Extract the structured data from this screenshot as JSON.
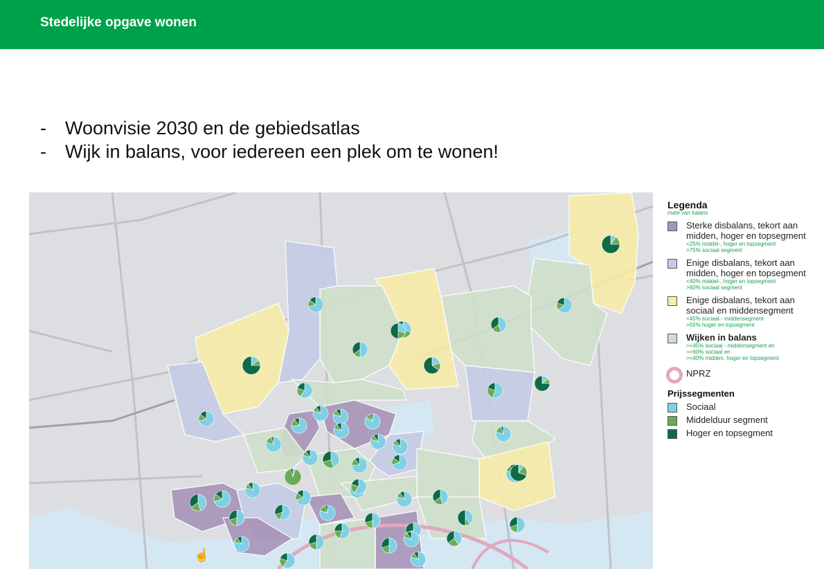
{
  "header": {
    "title": "Stedelijke opgave wonen",
    "color": "#00a14b"
  },
  "bullets": [
    {
      "dash": "-",
      "text": "Woonvisie 2030 en de gebiedsatlas"
    },
    {
      "dash": "-",
      "text": "Wijk in balans, voor iedereen een plek om te wonen!"
    }
  ],
  "legend": {
    "title": "Legenda",
    "subtitle": "mate van balans",
    "items": [
      {
        "label": "Sterke disbalans, tekort aan midden, hoger en topsegment",
        "notes": [
          "<25% middel-, hoger en topsegment",
          ">75% sociaal segment"
        ],
        "color": "#a794b8"
      },
      {
        "label": "Enige disbalans, tekort aan midden, hoger en topsegment",
        "notes": [
          "<40% middel-, hoger en topsegment",
          ">60% sociaal segment"
        ],
        "color": "#c3cbe4"
      },
      {
        "label": "Enige disbalans, tekort aan sociaal en middensegment",
        "notes": [
          "<45% sociaal - middensegment",
          ">55% hoger en topsegment"
        ],
        "color": "#f6eba9"
      },
      {
        "label": "Wijken in balans",
        "notes": [
          ">=45% sociaal - middensegment en",
          "=<60% sociaal en",
          ">=40%  midden, hoger en topsegment"
        ],
        "color": "#cfdfcb"
      }
    ],
    "nprz_label": "NPRZ",
    "prijs_title": "Prijssegmenten",
    "prijs": [
      {
        "label": "Sociaal",
        "color": "#7fd0e4"
      },
      {
        "label": "Middelduur segment",
        "color": "#6aab58"
      },
      {
        "label": "Hoger en topsegment",
        "color": "#0e6b48"
      }
    ]
  },
  "map": {
    "district_colors": {
      "purple": "#a794b8",
      "blue": "#c3cbe4",
      "yellow": "#f6eba9",
      "green": "#cfdfcb"
    },
    "pies": [
      {
        "social": 0.1,
        "mid": 0.15,
        "high": 0.75
      },
      {
        "social": 0.7,
        "mid": 0.15,
        "high": 0.15
      },
      {
        "social": 0.3,
        "mid": 0.2,
        "high": 0.5
      },
      {
        "social": 0.45,
        "mid": 0.2,
        "high": 0.35
      },
      {
        "social": 0.65,
        "mid": 0.15,
        "high": 0.2
      },
      {
        "social": 0.15,
        "mid": 0.1,
        "high": 0.75
      },
      {
        "social": 0.5,
        "mid": 0.15,
        "high": 0.35
      },
      {
        "social": 0.2,
        "mid": 0.15,
        "high": 0.65
      },
      {
        "social": 0.3,
        "mid": 0.2,
        "high": 0.5
      },
      {
        "social": 0.7,
        "mid": 0.15,
        "high": 0.15
      },
      {
        "social": 0.6,
        "mid": 0.2,
        "high": 0.2
      },
      {
        "social": 0.55,
        "mid": 0.25,
        "high": 0.2
      },
      {
        "social": 0.15,
        "mid": 0.1,
        "high": 0.75
      },
      {
        "social": 0.75,
        "mid": 0.15,
        "high": 0.1
      },
      {
        "social": 0.8,
        "mid": 0.1,
        "high": 0.1
      },
      {
        "social": 0.8,
        "mid": 0.1,
        "high": 0.1
      },
      {
        "social": 0.85,
        "mid": 0.1,
        "high": 0.05
      },
      {
        "social": 0.8,
        "mid": 0.1,
        "high": 0.1
      },
      {
        "social": 0.8,
        "mid": 0.1,
        "high": 0.1
      },
      {
        "social": 0.8,
        "mid": 0.15,
        "high": 0.05
      },
      {
        "social": 0.8,
        "mid": 0.1,
        "high": 0.1
      },
      {
        "social": 0.45,
        "mid": 0.25,
        "high": 0.3
      },
      {
        "social": 0.05,
        "mid": 0.9,
        "high": 0.05
      },
      {
        "social": 0.75,
        "mid": 0.15,
        "high": 0.1
      },
      {
        "social": 0.8,
        "mid": 0.1,
        "high": 0.1
      },
      {
        "social": 0.7,
        "mid": 0.15,
        "high": 0.15
      },
      {
        "social": 0.8,
        "mid": 0.15,
        "high": 0.05
      },
      {
        "social": 0.8,
        "mid": 0.1,
        "high": 0.1
      },
      {
        "social": 0.45,
        "mid": 0.2,
        "high": 0.35
      },
      {
        "social": 0.7,
        "mid": 0.15,
        "high": 0.15
      },
      {
        "social": 0.8,
        "mid": 0.1,
        "high": 0.1
      },
      {
        "social": 0.7,
        "mid": 0.15,
        "high": 0.15
      },
      {
        "social": 0.8,
        "mid": 0.15,
        "high": 0.05
      },
      {
        "social": 0.8,
        "mid": 0.15,
        "high": 0.05
      },
      {
        "social": 0.55,
        "mid": 0.15,
        "high": 0.3
      },
      {
        "social": 0.5,
        "mid": 0.2,
        "high": 0.3
      },
      {
        "social": 0.8,
        "mid": 0.1,
        "high": 0.1
      },
      {
        "social": 0.5,
        "mid": 0.2,
        "high": 0.3
      },
      {
        "social": 0.6,
        "mid": 0.2,
        "high": 0.2
      },
      {
        "social": 0.8,
        "mid": 0.1,
        "high": 0.1
      },
      {
        "social": 0.1,
        "mid": 0.2,
        "high": 0.7
      },
      {
        "social": 0.55,
        "mid": 0.15,
        "high": 0.3
      },
      {
        "social": 0.4,
        "mid": 0.25,
        "high": 0.35
      },
      {
        "social": 0.5,
        "mid": 0.2,
        "high": 0.3
      },
      {
        "social": 0.4,
        "mid": 0.1,
        "high": 0.5
      },
      {
        "social": 0.45,
        "mid": 0.2,
        "high": 0.35
      },
      {
        "social": 0.5,
        "mid": 0.2,
        "high": 0.3
      },
      {
        "social": 0.55,
        "mid": 0.2,
        "high": 0.25
      },
      {
        "social": 0.8,
        "mid": 0.1,
        "high": 0.1
      },
      {
        "social": 0.5,
        "mid": 0.2,
        "high": 0.3
      },
      {
        "social": 0.6,
        "mid": 0.2,
        "high": 0.2
      },
      {
        "social": 0.8,
        "mid": 0.1,
        "high": 0.1
      }
    ]
  }
}
